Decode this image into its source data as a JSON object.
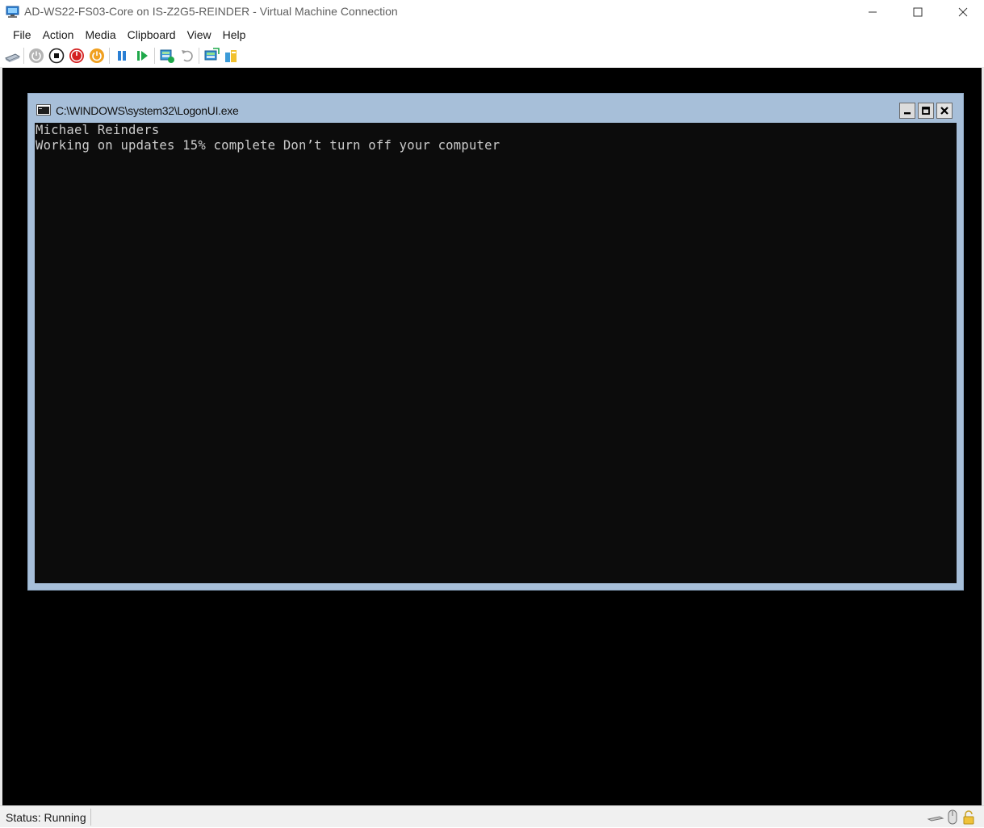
{
  "window": {
    "title": "AD-WS22-FS03-Core on IS-Z2G5-REINDER - Virtual Machine Connection",
    "icon": "vm-connection-icon"
  },
  "menu": [
    "File",
    "Action",
    "Media",
    "Clipboard",
    "View",
    "Help"
  ],
  "toolbar": [
    {
      "name": "ctrl-alt-del",
      "icon": "keyboard-icon"
    },
    {
      "name": "start",
      "icon": "power-icon"
    },
    {
      "name": "turn-off",
      "icon": "stop-icon"
    },
    {
      "name": "shut-down",
      "icon": "shutdown-icon"
    },
    {
      "name": "save",
      "icon": "save-state-icon"
    },
    {
      "name": "pause",
      "icon": "pause-icon"
    },
    {
      "name": "resume",
      "icon": "resume-icon"
    },
    {
      "name": "checkpoint",
      "icon": "checkpoint-icon"
    },
    {
      "name": "revert",
      "icon": "revert-icon"
    },
    {
      "name": "enhanced-session",
      "icon": "enhanced-session-icon"
    },
    {
      "name": "share",
      "icon": "share-icon"
    }
  ],
  "console": {
    "title": "C:\\WINDOWS\\system32\\LogonUI.exe",
    "lines": [
      "Michael Reinders",
      "Working on updates 15% complete Don’t turn off your computer"
    ]
  },
  "status": {
    "text": "Status: Running"
  },
  "colors": {
    "console_frame": "#a7bfd9",
    "console_bg": "#0c0c0c",
    "console_text": "#cccccc",
    "vm_bg": "#000000"
  }
}
